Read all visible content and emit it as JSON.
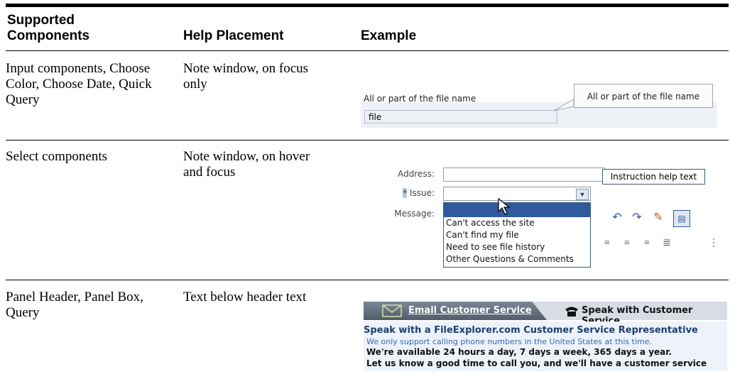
{
  "headers": {
    "col1": "Supported Components",
    "col2": "Help Placement",
    "col3": "Example"
  },
  "rows": [
    {
      "components": "Input components, Choose Color, Choose Date, Quick Query",
      "placement": "Note window, on focus only",
      "example": {
        "label": "All or part of the file name",
        "input_value": "file",
        "note_text": "All or part of the file name"
      }
    },
    {
      "components": "Select components",
      "placement": "Note window, on hover and focus",
      "example": {
        "address_label": "Address:",
        "issue_label": "Issue:",
        "message_label": "Message:",
        "required_mark": "*",
        "note_text": "Instruction help text",
        "options": [
          "Can't access the site",
          "Can't find my file",
          "Need to see file history",
          "Other Questions & Comments"
        ]
      }
    },
    {
      "components": "Panel Header, Panel Box, Query",
      "placement": "Text below header text",
      "example": {
        "tab1": "Email Customer Service",
        "tab2": "Speak with Customer Service",
        "title": "Speak with a FileExplorer.com Customer Service Representative",
        "subtitle": "We only support calling phone numbers in the United States at this time.",
        "line1": "We're available 24 hours a day, 7 days a week, 365 days a year.",
        "line2": "Let us know a good time to call you, and we'll have a customer service"
      }
    }
  ],
  "icons": [
    "envelope-icon",
    "phone-icon",
    "cursor-icon",
    "dropdown-arrow-icon",
    "undo-icon",
    "redo-icon",
    "eraser-icon",
    "align-icon"
  ]
}
